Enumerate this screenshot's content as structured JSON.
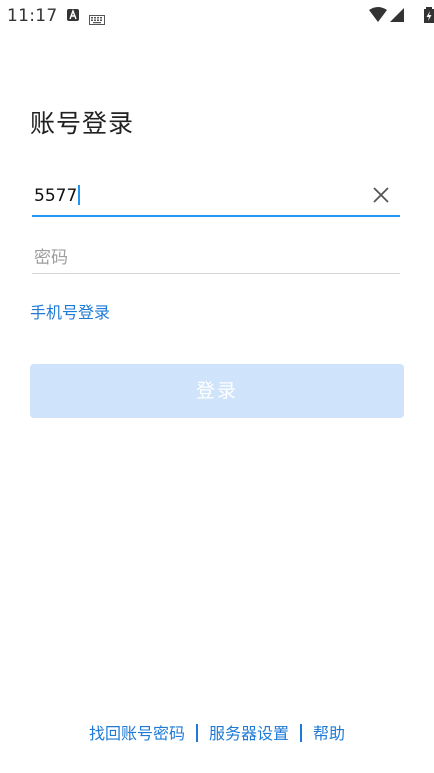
{
  "status_bar": {
    "time": "11:17",
    "icons": [
      "a-notification-icon",
      "keyboard-icon",
      "wifi-icon",
      "cell-signal-icon",
      "battery-icon"
    ]
  },
  "login": {
    "title": "账号登录",
    "account_value": "5577",
    "password_placeholder": "密码",
    "phone_login_label": "手机号登录",
    "login_button_label": "登录"
  },
  "footer": {
    "find_password_label": "找回账号密码",
    "server_settings_label": "服务器设置",
    "help_label": "帮助"
  },
  "colors": {
    "accent": "#2196f3",
    "link": "#1e7ad6",
    "button_disabled_bg": "#cfe3fb"
  }
}
